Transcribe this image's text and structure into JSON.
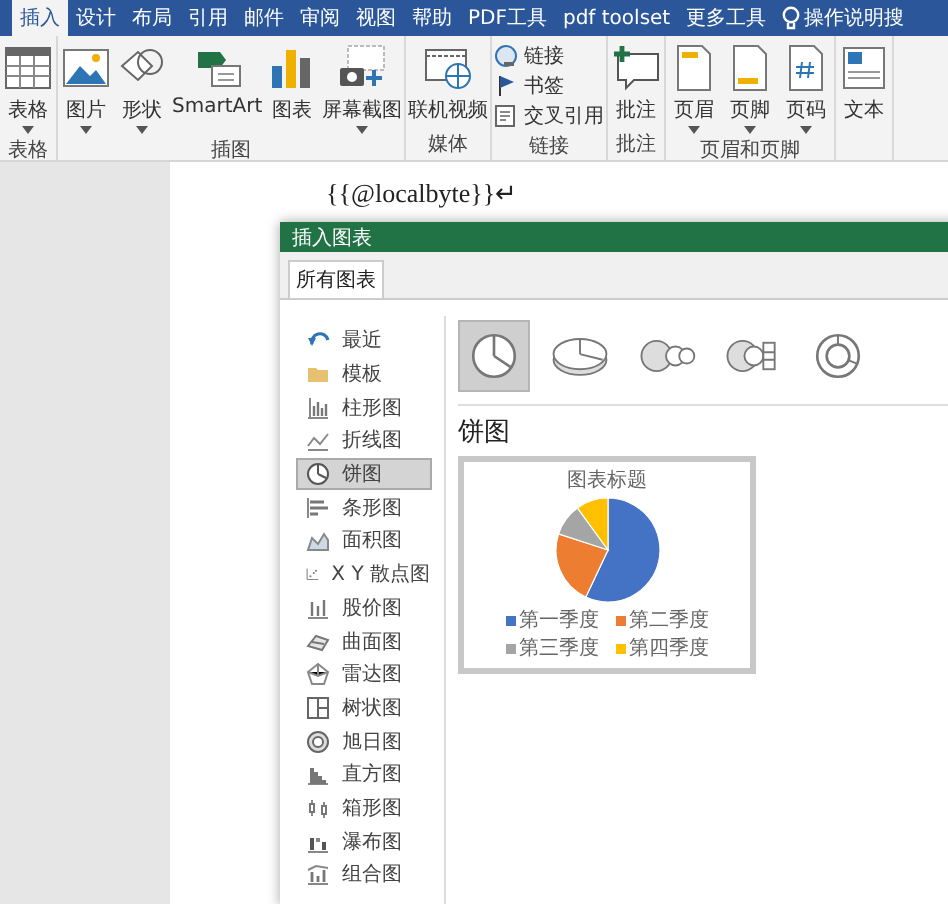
{
  "ribbon_tabs": [
    {
      "label": "插入",
      "selected": true
    },
    {
      "label": "设计",
      "selected": false
    },
    {
      "label": "布局",
      "selected": false
    },
    {
      "label": "引用",
      "selected": false
    },
    {
      "label": "邮件",
      "selected": false
    },
    {
      "label": "审阅",
      "selected": false
    },
    {
      "label": "视图",
      "selected": false
    },
    {
      "label": "帮助",
      "selected": false
    },
    {
      "label": "PDF工具",
      "selected": false
    },
    {
      "label": "pdf toolset",
      "selected": false
    },
    {
      "label": "更多工具",
      "selected": false
    }
  ],
  "search": {
    "placeholder": "操作说明搜"
  },
  "ribbon_groups": [
    {
      "label": "表格",
      "items": [
        {
          "label": "表格",
          "kind": "large",
          "dropdown": true
        }
      ]
    },
    {
      "label": "插图",
      "items": [
        {
          "label": "图片",
          "kind": "large",
          "dropdown": true
        },
        {
          "label": "形状",
          "kind": "large",
          "dropdown": true
        },
        {
          "label": "SmartArt",
          "kind": "large",
          "dropdown": false
        },
        {
          "label": "图表",
          "kind": "large",
          "dropdown": false
        },
        {
          "label": "屏幕截图",
          "kind": "large",
          "dropdown": true
        }
      ]
    },
    {
      "label": "媒体",
      "items": [
        {
          "label": "联机视频",
          "kind": "large",
          "dropdown": false
        }
      ]
    },
    {
      "label": "链接",
      "items": [
        {
          "label": "链接",
          "kind": "small",
          "dropdown": false
        },
        {
          "label": "书签",
          "kind": "small",
          "dropdown": false
        },
        {
          "label": "交叉引用",
          "kind": "small",
          "dropdown": false
        }
      ]
    },
    {
      "label": "批注",
      "items": [
        {
          "label": "批注",
          "kind": "large",
          "dropdown": false
        }
      ]
    },
    {
      "label": "页眉和页脚",
      "items": [
        {
          "label": "页眉",
          "kind": "large",
          "dropdown": true
        },
        {
          "label": "页脚",
          "kind": "large",
          "dropdown": true
        },
        {
          "label": "页码",
          "kind": "large",
          "dropdown": true
        }
      ]
    },
    {
      "items": [
        {
          "label": "文本",
          "kind": "large",
          "dropdown": false
        }
      ]
    }
  ],
  "document": {
    "lines": [
      "{{@localbyte}}↵"
    ]
  },
  "dialog": {
    "title": "插入图表",
    "tabs": [
      {
        "label": "所有图表",
        "selected": true
      }
    ],
    "chart_types": [
      {
        "label": "最近",
        "selected": false
      },
      {
        "label": "模板",
        "selected": false
      },
      {
        "label": "柱形图",
        "selected": false
      },
      {
        "label": "折线图",
        "selected": false
      },
      {
        "label": "饼图",
        "selected": true
      },
      {
        "label": "条形图",
        "selected": false
      },
      {
        "label": "面积图",
        "selected": false
      },
      {
        "label": "X Y 散点图",
        "selected": false
      },
      {
        "label": "股价图",
        "selected": false
      },
      {
        "label": "曲面图",
        "selected": false
      },
      {
        "label": "雷达图",
        "selected": false
      },
      {
        "label": "树状图",
        "selected": false
      },
      {
        "label": "旭日图",
        "selected": false
      },
      {
        "label": "直方图",
        "selected": false
      },
      {
        "label": "箱形图",
        "selected": false
      },
      {
        "label": "瀑布图",
        "selected": false
      },
      {
        "label": "组合图",
        "selected": false
      }
    ],
    "subtypes": [
      {
        "selected": true
      },
      {
        "selected": false
      },
      {
        "selected": false
      },
      {
        "selected": false
      },
      {
        "selected": false
      }
    ],
    "heading": "饼图",
    "preview": {
      "title": "图表标题",
      "legend": [
        {
          "label": "第一季度",
          "color": "#4472c4"
        },
        {
          "label": "第二季度",
          "color": "#ed7d31"
        },
        {
          "label": "第三季度",
          "color": "#a5a5a5"
        },
        {
          "label": "第四季度",
          "color": "#ffc000"
        }
      ]
    }
  }
}
